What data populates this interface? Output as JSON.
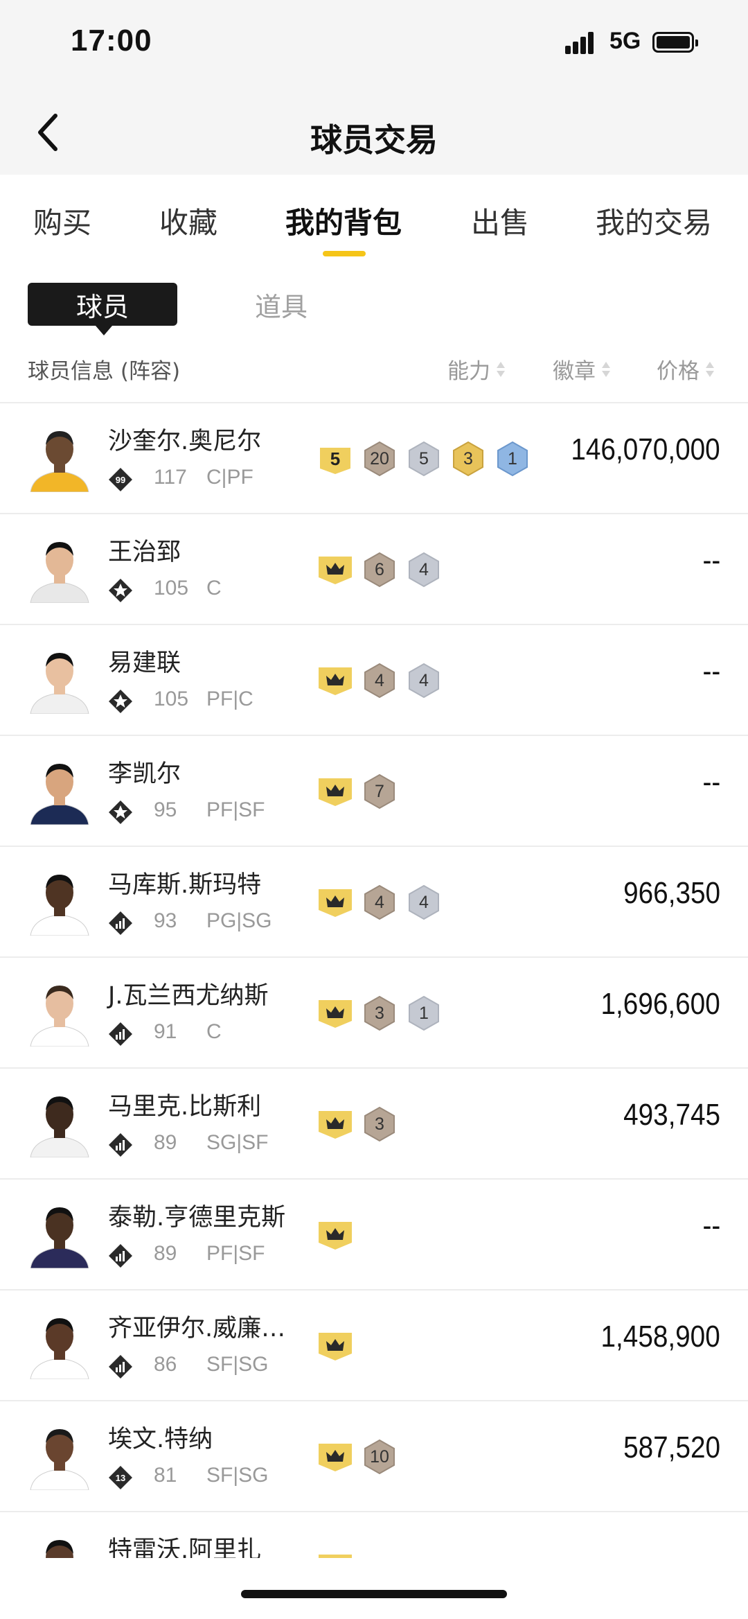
{
  "status": {
    "time": "17:00",
    "network": "5G"
  },
  "nav": {
    "title": "球员交易"
  },
  "tabs": [
    {
      "label": "购买",
      "active": false
    },
    {
      "label": "收藏",
      "active": false
    },
    {
      "label": "我的背包",
      "active": true
    },
    {
      "label": "出售",
      "active": false
    },
    {
      "label": "我的交易",
      "active": false
    }
  ],
  "segments": [
    {
      "label": "球员",
      "active": true
    },
    {
      "label": "道具",
      "active": false
    }
  ],
  "header": {
    "info": "球员信息 (阵容)",
    "ability": "能力",
    "badge": "徽章",
    "price": "价格"
  },
  "colors": {
    "accent": "#f5c518",
    "gold": "#e8c35a",
    "bronze": "#b6a595",
    "silver": "#c5c9d2",
    "blue": "#8fb6e3"
  },
  "players": [
    {
      "name": "沙奎尔.奥尼尔",
      "rank_icon": "rank-99-icon",
      "rank_label": "99",
      "ovr": "117",
      "pos": "C|PF",
      "price": "146,070,000",
      "badges": [
        {
          "type": "gold-square",
          "value": "5"
        },
        {
          "type": "bronze",
          "value": "20"
        },
        {
          "type": "silver",
          "value": "5"
        },
        {
          "type": "gold",
          "value": "3"
        },
        {
          "type": "blue",
          "value": "1"
        }
      ]
    },
    {
      "name": "王治郅",
      "rank_icon": "star-rank-icon",
      "rank_label": "",
      "ovr": "105",
      "pos": "C",
      "price": "--",
      "badges": [
        {
          "type": "crown",
          "value": ""
        },
        {
          "type": "bronze",
          "value": "6"
        },
        {
          "type": "silver",
          "value": "4"
        }
      ]
    },
    {
      "name": "易建联",
      "rank_icon": "star-rank-icon",
      "rank_label": "",
      "ovr": "105",
      "pos": "PF|C",
      "price": "--",
      "badges": [
        {
          "type": "crown",
          "value": ""
        },
        {
          "type": "bronze",
          "value": "4"
        },
        {
          "type": "silver",
          "value": "4"
        }
      ]
    },
    {
      "name": "李凯尔",
      "rank_icon": "star-rank-icon",
      "rank_label": "",
      "ovr": "95",
      "pos": "PF|SF",
      "price": "--",
      "badges": [
        {
          "type": "crown",
          "value": ""
        },
        {
          "type": "bronze",
          "value": "7"
        }
      ]
    },
    {
      "name": "马库斯.斯玛特",
      "rank_icon": "bars-rank-icon",
      "rank_label": "",
      "ovr": "93",
      "pos": "PG|SG",
      "price": "966,350",
      "badges": [
        {
          "type": "crown",
          "value": ""
        },
        {
          "type": "bronze",
          "value": "4"
        },
        {
          "type": "silver",
          "value": "4"
        }
      ]
    },
    {
      "name": "J.瓦兰西尤纳斯",
      "rank_icon": "bars-rank-icon",
      "rank_label": "",
      "ovr": "91",
      "pos": "C",
      "price": "1,696,600",
      "badges": [
        {
          "type": "crown",
          "value": ""
        },
        {
          "type": "bronze",
          "value": "3"
        },
        {
          "type": "silver",
          "value": "1"
        }
      ]
    },
    {
      "name": "马里克.比斯利",
      "rank_icon": "bars-rank-icon",
      "rank_label": "",
      "ovr": "89",
      "pos": "SG|SF",
      "price": "493,745",
      "badges": [
        {
          "type": "crown",
          "value": ""
        },
        {
          "type": "bronze",
          "value": "3"
        }
      ]
    },
    {
      "name": "泰勒.亨德里克斯",
      "rank_icon": "bars-rank-icon",
      "rank_label": "",
      "ovr": "89",
      "pos": "PF|SF",
      "price": "--",
      "badges": [
        {
          "type": "crown",
          "value": ""
        }
      ]
    },
    {
      "name": "齐亚伊尔.威廉…",
      "rank_icon": "bars-rank-icon",
      "rank_label": "",
      "ovr": "86",
      "pos": "SF|SG",
      "price": "1,458,900",
      "badges": [
        {
          "type": "crown",
          "value": ""
        }
      ]
    },
    {
      "name": "埃文.特纳",
      "rank_icon": "rank-13-icon",
      "rank_label": "13",
      "ovr": "81",
      "pos": "SF|SG",
      "price": "587,520",
      "badges": [
        {
          "type": "crown",
          "value": ""
        },
        {
          "type": "bronze",
          "value": "10"
        }
      ]
    },
    {
      "name": "特雷沃.阿里扎",
      "rank_icon": "bars-rank-icon",
      "rank_label": "",
      "ovr": "",
      "pos": "",
      "price": "",
      "badges": [
        {
          "type": "crown",
          "value": ""
        }
      ]
    }
  ]
}
